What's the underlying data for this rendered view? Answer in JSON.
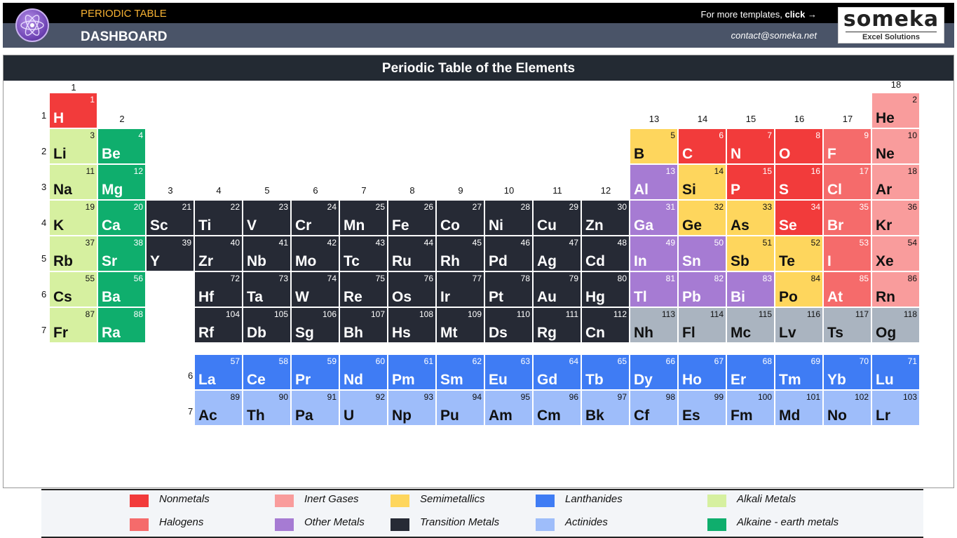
{
  "header": {
    "subtitle": "PERIODIC TABLE",
    "title": "DASHBOARD",
    "more_text": "For more templates, ",
    "more_click": "click →",
    "contact": "contact@someka.net",
    "brand_name": "someka",
    "brand_tag": "Excel Solutions"
  },
  "panel": {
    "title": "Periodic Table of the Elements"
  },
  "colors": {
    "nonmetal": "#f23b3b",
    "halogen": "#f56b6b",
    "inert": "#f99c9c",
    "semimetal": "#fed65d",
    "other_metal": "#a67bd3",
    "transition": "#262a35",
    "lanthanide": "#3f7cf4",
    "actinide": "#9ebdfa",
    "alkali": "#d6f0a0",
    "alkaline": "#0fae6d",
    "unknown": "#aab4c0"
  },
  "group_labels": [
    "1",
    "2",
    "3",
    "4",
    "5",
    "6",
    "7",
    "8",
    "9",
    "10",
    "11",
    "12",
    "13",
    "14",
    "15",
    "16",
    "17",
    "18"
  ],
  "period_labels": [
    "1",
    "2",
    "3",
    "4",
    "5",
    "6",
    "7"
  ],
  "series_labels": [
    "6",
    "7"
  ],
  "elements": [
    {
      "s": "H",
      "n": "1",
      "c": "nonmetal"
    },
    {
      "s": "He",
      "n": "2",
      "c": "inert"
    },
    {
      "s": "Li",
      "n": "3",
      "c": "alkali"
    },
    {
      "s": "Be",
      "n": "4",
      "c": "alkaline"
    },
    {
      "s": "B",
      "n": "5",
      "c": "semimetal"
    },
    {
      "s": "C",
      "n": "6",
      "c": "nonmetal"
    },
    {
      "s": "N",
      "n": "7",
      "c": "nonmetal"
    },
    {
      "s": "O",
      "n": "8",
      "c": "nonmetal"
    },
    {
      "s": "F",
      "n": "9",
      "c": "halogen"
    },
    {
      "s": "Ne",
      "n": "10",
      "c": "inert"
    },
    {
      "s": "Na",
      "n": "11",
      "c": "alkali"
    },
    {
      "s": "Mg",
      "n": "12",
      "c": "alkaline"
    },
    {
      "s": "Al",
      "n": "13",
      "c": "other_metal"
    },
    {
      "s": "Si",
      "n": "14",
      "c": "semimetal"
    },
    {
      "s": "P",
      "n": "15",
      "c": "nonmetal"
    },
    {
      "s": "S",
      "n": "16",
      "c": "nonmetal"
    },
    {
      "s": "Cl",
      "n": "17",
      "c": "halogen"
    },
    {
      "s": "Ar",
      "n": "18",
      "c": "inert"
    },
    {
      "s": "K",
      "n": "19",
      "c": "alkali"
    },
    {
      "s": "Ca",
      "n": "20",
      "c": "alkaline"
    },
    {
      "s": "Sc",
      "n": "21",
      "c": "transition"
    },
    {
      "s": "Ti",
      "n": "22",
      "c": "transition"
    },
    {
      "s": "V",
      "n": "23",
      "c": "transition"
    },
    {
      "s": "Cr",
      "n": "24",
      "c": "transition"
    },
    {
      "s": "Mn",
      "n": "25",
      "c": "transition"
    },
    {
      "s": "Fe",
      "n": "26",
      "c": "transition"
    },
    {
      "s": "Co",
      "n": "27",
      "c": "transition"
    },
    {
      "s": "Ni",
      "n": "28",
      "c": "transition"
    },
    {
      "s": "Cu",
      "n": "29",
      "c": "transition"
    },
    {
      "s": "Zn",
      "n": "30",
      "c": "transition"
    },
    {
      "s": "Ga",
      "n": "31",
      "c": "other_metal"
    },
    {
      "s": "Ge",
      "n": "32",
      "c": "semimetal"
    },
    {
      "s": "As",
      "n": "33",
      "c": "semimetal"
    },
    {
      "s": "Se",
      "n": "34",
      "c": "nonmetal"
    },
    {
      "s": "Br",
      "n": "35",
      "c": "halogen"
    },
    {
      "s": "Kr",
      "n": "36",
      "c": "inert"
    },
    {
      "s": "Rb",
      "n": "37",
      "c": "alkali"
    },
    {
      "s": "Sr",
      "n": "38",
      "c": "alkaline"
    },
    {
      "s": "Y",
      "n": "39",
      "c": "transition"
    },
    {
      "s": "Zr",
      "n": "40",
      "c": "transition"
    },
    {
      "s": "Nb",
      "n": "41",
      "c": "transition"
    },
    {
      "s": "Mo",
      "n": "42",
      "c": "transition"
    },
    {
      "s": "Tc",
      "n": "43",
      "c": "transition"
    },
    {
      "s": "Ru",
      "n": "44",
      "c": "transition"
    },
    {
      "s": "Rh",
      "n": "45",
      "c": "transition"
    },
    {
      "s": "Pd",
      "n": "46",
      "c": "transition"
    },
    {
      "s": "Ag",
      "n": "47",
      "c": "transition"
    },
    {
      "s": "Cd",
      "n": "48",
      "c": "transition"
    },
    {
      "s": "In",
      "n": "49",
      "c": "other_metal"
    },
    {
      "s": "Sn",
      "n": "50",
      "c": "other_metal"
    },
    {
      "s": "Sb",
      "n": "51",
      "c": "semimetal"
    },
    {
      "s": "Te",
      "n": "52",
      "c": "semimetal"
    },
    {
      "s": "I",
      "n": "53",
      "c": "halogen"
    },
    {
      "s": "Xe",
      "n": "54",
      "c": "inert"
    },
    {
      "s": "Cs",
      "n": "55",
      "c": "alkali"
    },
    {
      "s": "Ba",
      "n": "56",
      "c": "alkaline"
    },
    {
      "s": "Hf",
      "n": "72",
      "c": "transition"
    },
    {
      "s": "Ta",
      "n": "73",
      "c": "transition"
    },
    {
      "s": "W",
      "n": "74",
      "c": "transition"
    },
    {
      "s": "Re",
      "n": "75",
      "c": "transition"
    },
    {
      "s": "Os",
      "n": "76",
      "c": "transition"
    },
    {
      "s": "Ir",
      "n": "77",
      "c": "transition"
    },
    {
      "s": "Pt",
      "n": "78",
      "c": "transition"
    },
    {
      "s": "Au",
      "n": "79",
      "c": "transition"
    },
    {
      "s": "Hg",
      "n": "80",
      "c": "transition"
    },
    {
      "s": "Tl",
      "n": "81",
      "c": "other_metal"
    },
    {
      "s": "Pb",
      "n": "82",
      "c": "other_metal"
    },
    {
      "s": "Bi",
      "n": "83",
      "c": "other_metal"
    },
    {
      "s": "Po",
      "n": "84",
      "c": "semimetal"
    },
    {
      "s": "At",
      "n": "85",
      "c": "halogen"
    },
    {
      "s": "Rn",
      "n": "86",
      "c": "inert"
    },
    {
      "s": "Fr",
      "n": "87",
      "c": "alkali"
    },
    {
      "s": "Ra",
      "n": "88",
      "c": "alkaline"
    },
    {
      "s": "Rf",
      "n": "104",
      "c": "transition"
    },
    {
      "s": "Db",
      "n": "105",
      "c": "transition"
    },
    {
      "s": "Sg",
      "n": "106",
      "c": "transition"
    },
    {
      "s": "Bh",
      "n": "107",
      "c": "transition"
    },
    {
      "s": "Hs",
      "n": "108",
      "c": "transition"
    },
    {
      "s": "Mt",
      "n": "109",
      "c": "transition"
    },
    {
      "s": "Ds",
      "n": "110",
      "c": "transition"
    },
    {
      "s": "Rg",
      "n": "111",
      "c": "transition"
    },
    {
      "s": "Cn",
      "n": "112",
      "c": "transition"
    },
    {
      "s": "Nh",
      "n": "113",
      "c": "unknown"
    },
    {
      "s": "Fl",
      "n": "114",
      "c": "unknown"
    },
    {
      "s": "Mc",
      "n": "115",
      "c": "unknown"
    },
    {
      "s": "Lv",
      "n": "116",
      "c": "unknown"
    },
    {
      "s": "Ts",
      "n": "117",
      "c": "unknown"
    },
    {
      "s": "Og",
      "n": "118",
      "c": "unknown"
    },
    {
      "s": "La",
      "n": "57",
      "c": "lanthanide"
    },
    {
      "s": "Ce",
      "n": "58",
      "c": "lanthanide"
    },
    {
      "s": "Pr",
      "n": "59",
      "c": "lanthanide"
    },
    {
      "s": "Nd",
      "n": "60",
      "c": "lanthanide"
    },
    {
      "s": "Pm",
      "n": "61",
      "c": "lanthanide"
    },
    {
      "s": "Sm",
      "n": "62",
      "c": "lanthanide"
    },
    {
      "s": "Eu",
      "n": "63",
      "c": "lanthanide"
    },
    {
      "s": "Gd",
      "n": "64",
      "c": "lanthanide"
    },
    {
      "s": "Tb",
      "n": "65",
      "c": "lanthanide"
    },
    {
      "s": "Dy",
      "n": "66",
      "c": "lanthanide"
    },
    {
      "s": "Ho",
      "n": "67",
      "c": "lanthanide"
    },
    {
      "s": "Er",
      "n": "68",
      "c": "lanthanide"
    },
    {
      "s": "Tm",
      "n": "69",
      "c": "lanthanide"
    },
    {
      "s": "Yb",
      "n": "70",
      "c": "lanthanide"
    },
    {
      "s": "Lu",
      "n": "71",
      "c": "lanthanide"
    },
    {
      "s": "Ac",
      "n": "89",
      "c": "actinide"
    },
    {
      "s": "Th",
      "n": "90",
      "c": "actinide"
    },
    {
      "s": "Pa",
      "n": "91",
      "c": "actinide"
    },
    {
      "s": "U",
      "n": "92",
      "c": "actinide"
    },
    {
      "s": "Np",
      "n": "93",
      "c": "actinide"
    },
    {
      "s": "Pu",
      "n": "94",
      "c": "actinide"
    },
    {
      "s": "Am",
      "n": "95",
      "c": "actinide"
    },
    {
      "s": "Cm",
      "n": "96",
      "c": "actinide"
    },
    {
      "s": "Bk",
      "n": "97",
      "c": "actinide"
    },
    {
      "s": "Cf",
      "n": "98",
      "c": "actinide"
    },
    {
      "s": "Es",
      "n": "99",
      "c": "actinide"
    },
    {
      "s": "Fm",
      "n": "100",
      "c": "actinide"
    },
    {
      "s": "Md",
      "n": "101",
      "c": "actinide"
    },
    {
      "s": "No",
      "n": "102",
      "c": "actinide"
    },
    {
      "s": "Lr",
      "n": "103",
      "c": "actinide"
    }
  ],
  "legend": [
    {
      "label": "Nonmetals",
      "c": "nonmetal"
    },
    {
      "label": "Halogens",
      "c": "halogen"
    },
    {
      "label": "Inert Gases",
      "c": "inert"
    },
    {
      "label": "Other Metals",
      "c": "other_metal"
    },
    {
      "label": "Semimetallics",
      "c": "semimetal"
    },
    {
      "label": "Transition Metals",
      "c": "transition"
    },
    {
      "label": "Lanthanides",
      "c": "lanthanide"
    },
    {
      "label": "Actinides",
      "c": "actinide"
    },
    {
      "label": "Alkali Metals",
      "c": "alkali"
    },
    {
      "label": "Alkaine - earth metals",
      "c": "alkaline"
    }
  ]
}
